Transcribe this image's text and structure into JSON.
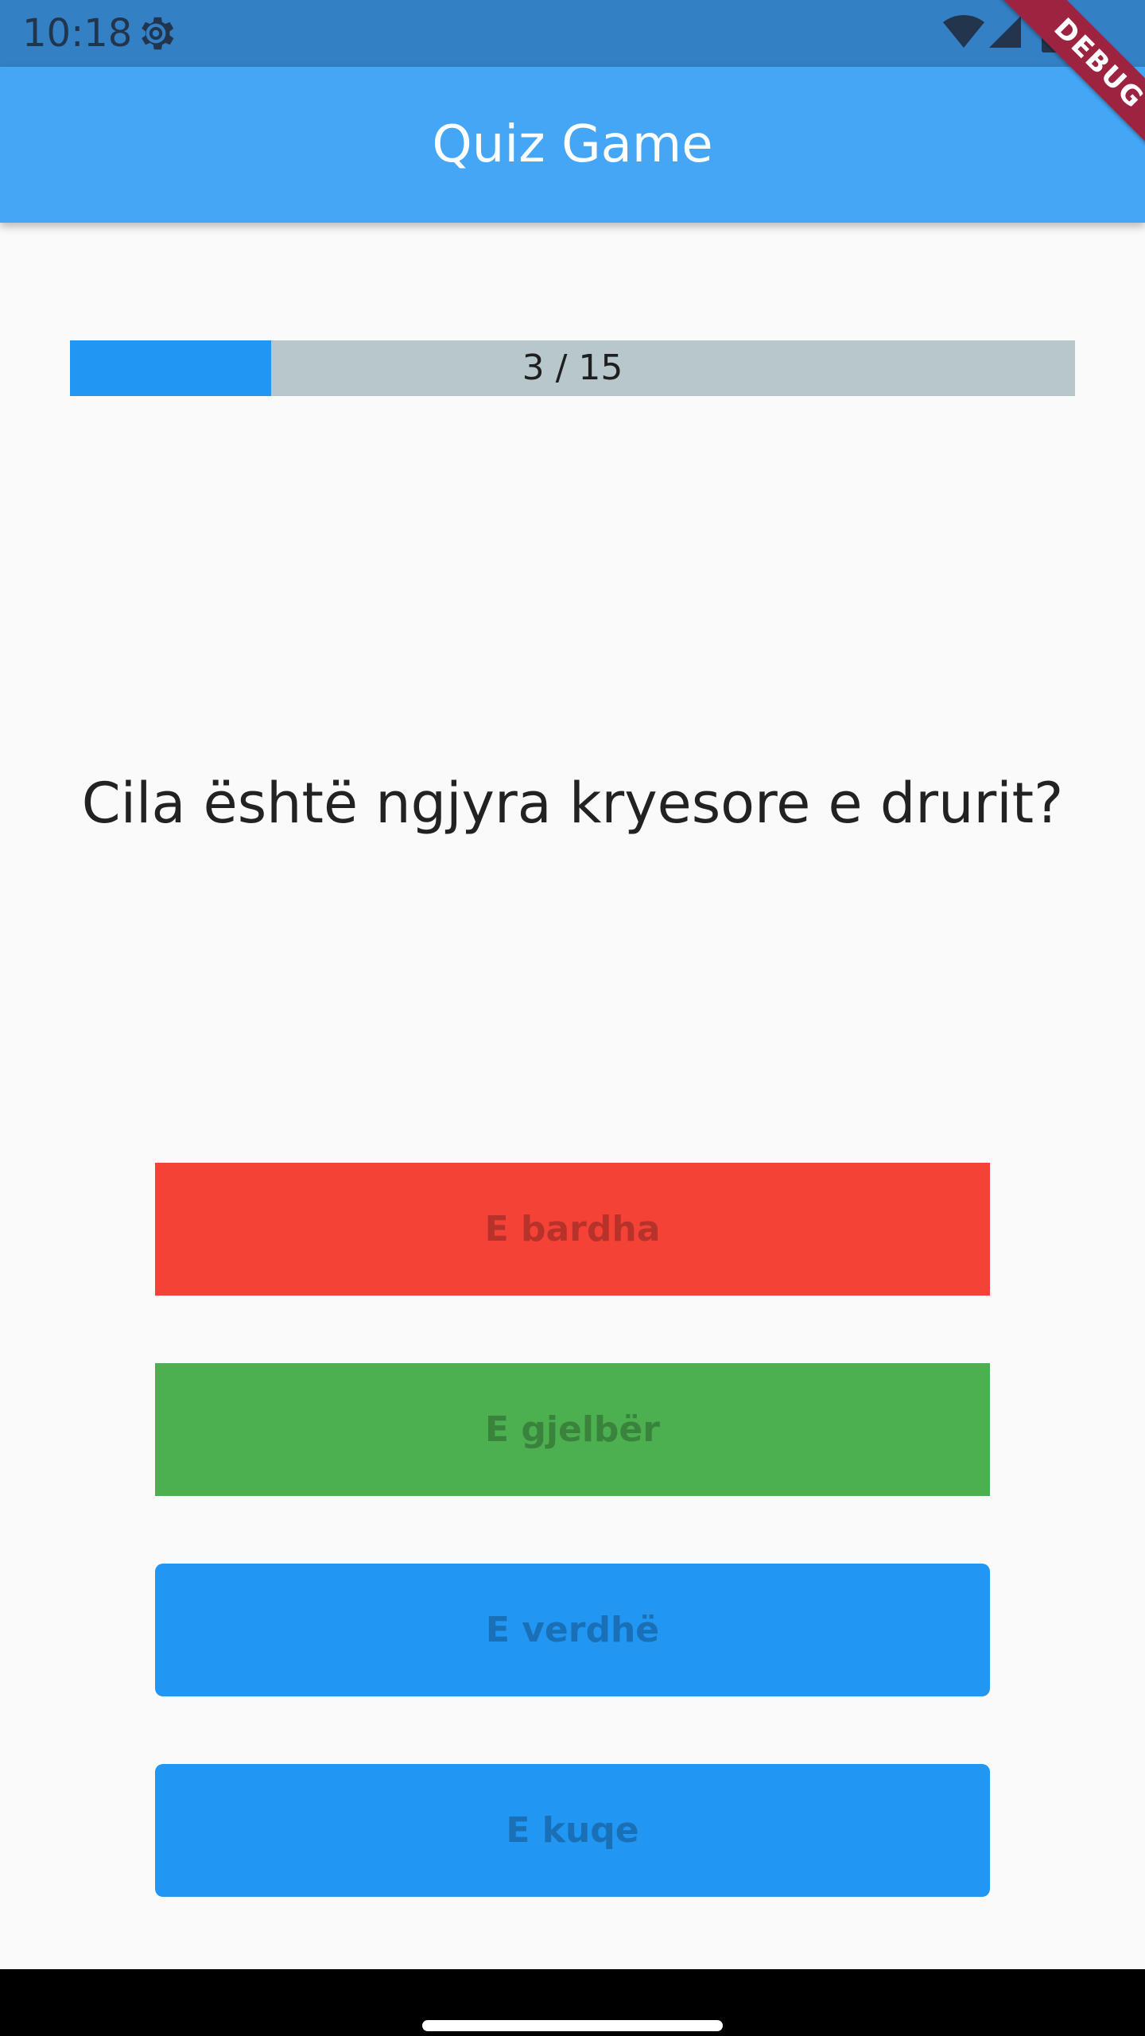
{
  "status_bar": {
    "time": "10:18",
    "icons": [
      "settings-gear-icon",
      "wifi-icon",
      "cell-signal-icon",
      "battery-icon"
    ]
  },
  "debug_banner": "DEBUG",
  "app_bar": {
    "title": "Quiz Game"
  },
  "progress": {
    "label": "3 / 15",
    "current": 3,
    "total": 15,
    "fraction": 0.2
  },
  "question": "Cila është ngjyra kryesore e drurit?",
  "answers": [
    {
      "label": "E bardha",
      "state": "incorrect",
      "background": "#f44336",
      "text_color": "#b8322c"
    },
    {
      "label": "E gjelbër",
      "state": "correct",
      "background": "#4caf50",
      "text_color": "#39833c"
    },
    {
      "label": "E verdhë",
      "state": "neutral",
      "background": "#2196f3",
      "text_color": "#1970b6"
    },
    {
      "label": "E kuqe",
      "state": "neutral",
      "background": "#2196f3",
      "text_color": "#1970b6"
    }
  ],
  "colors": {
    "status_bar": "#3380c4",
    "app_bar": "#44a6f4",
    "progress_fill": "#2196f3",
    "progress_track": "#b8c7cc",
    "background": "#fafafa",
    "debug_ribbon": "#9c2441"
  }
}
